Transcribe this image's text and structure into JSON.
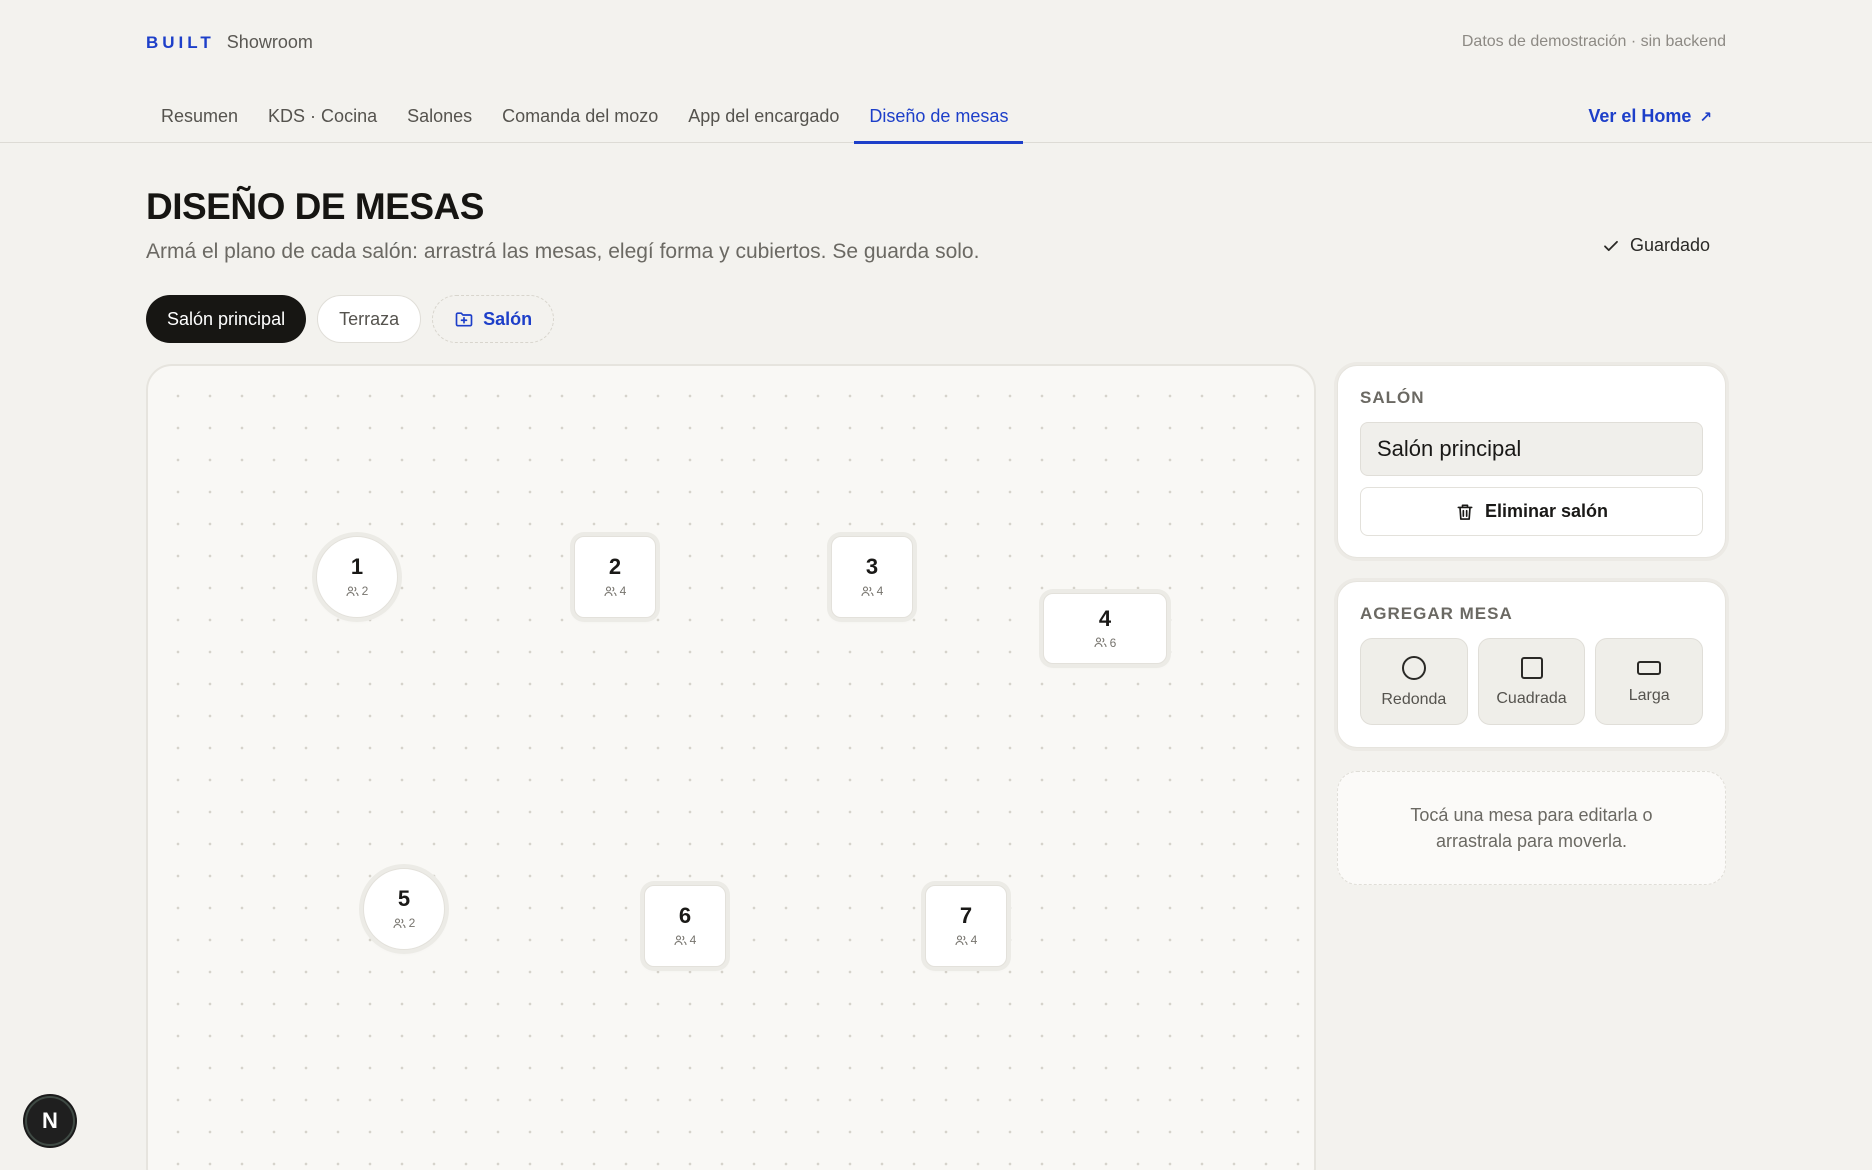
{
  "brand": {
    "mark": "BUILT",
    "name": "Showroom"
  },
  "demo_note": "Datos de demostración · sin backend",
  "nav": {
    "tabs": [
      {
        "label": "Resumen"
      },
      {
        "label": "KDS · Cocina"
      },
      {
        "label": "Salones"
      },
      {
        "label": "Comanda del mozo"
      },
      {
        "label": "App del encargado"
      },
      {
        "label": "Diseño de mesas",
        "active": true
      }
    ],
    "home_link": "Ver el Home",
    "home_arrow": "↗"
  },
  "page": {
    "title": "DISEÑO DE MESAS",
    "subtitle": "Armá el plano de cada salón: arrastrá las mesas, elegí forma y cubiertos. Se guarda solo.",
    "saved_status": "Guardado"
  },
  "rooms": {
    "tabs": [
      {
        "label": "Salón principal",
        "active": true
      },
      {
        "label": "Terraza"
      }
    ],
    "add_label": "Salón"
  },
  "tables": [
    {
      "number": "1",
      "seats": "2",
      "shape": "round"
    },
    {
      "number": "2",
      "seats": "4",
      "shape": "square"
    },
    {
      "number": "3",
      "seats": "4",
      "shape": "square"
    },
    {
      "number": "4",
      "seats": "6",
      "shape": "long"
    },
    {
      "number": "5",
      "seats": "2",
      "shape": "round"
    },
    {
      "number": "6",
      "seats": "4",
      "shape": "square"
    },
    {
      "number": "7",
      "seats": "4",
      "shape": "square"
    }
  ],
  "room_panel": {
    "title": "SALÓN",
    "name_value": "Salón principal",
    "delete_label": "Eliminar salón"
  },
  "add_table_panel": {
    "title": "AGREGAR MESA",
    "shapes": [
      {
        "label": "Redonda",
        "icon": "circle-icon"
      },
      {
        "label": "Cuadrada",
        "icon": "square-icon"
      },
      {
        "label": "Larga",
        "icon": "rectangle-icon"
      }
    ]
  },
  "hint": "Tocá una mesa para editarla o arrastrala para moverla.",
  "dev_badge": "N",
  "colors": {
    "accent": "#1d3fc9",
    "dark": "#171613",
    "background": "#f3f2ee"
  }
}
